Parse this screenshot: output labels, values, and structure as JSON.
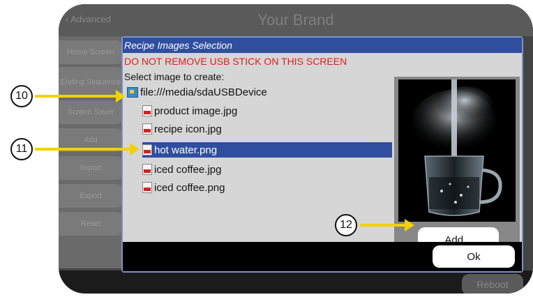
{
  "header": {
    "back_label": "Advanced",
    "brand": "Your Brand"
  },
  "sidebar": {
    "items": [
      {
        "label": "Home Screen"
      },
      {
        "label": "Ending Sequence"
      },
      {
        "label": "Screen Saver"
      },
      {
        "label": "Add"
      },
      {
        "label": "Import"
      },
      {
        "label": "Export"
      },
      {
        "label": "Reset"
      }
    ]
  },
  "dialog": {
    "title": "Recipe Images Selection",
    "warning": "DO NOT REMOVE USB STICK ON THIS SCREEN",
    "prompt": "Select image to create:",
    "root": "file:///media/sdaUSBDevice",
    "files": [
      {
        "name": "product image.jpg",
        "selected": false
      },
      {
        "name": "recipe icon.jpg",
        "selected": false
      },
      {
        "name": "hot water.png",
        "selected": true
      },
      {
        "name": "iced coffee.jpg",
        "selected": false
      },
      {
        "name": "iced coffee.png",
        "selected": false
      }
    ],
    "add_label": "Add...",
    "ok_label": "Ok"
  },
  "footer": {
    "reboot_label": "Reboot"
  },
  "callouts": {
    "c10": "10",
    "c11": "11",
    "c12": "12"
  },
  "colors": {
    "title_bar": "#2f4ea0",
    "selection": "#2f4ea0",
    "warning": "#e11b1b",
    "arrow": "#f2d100"
  }
}
